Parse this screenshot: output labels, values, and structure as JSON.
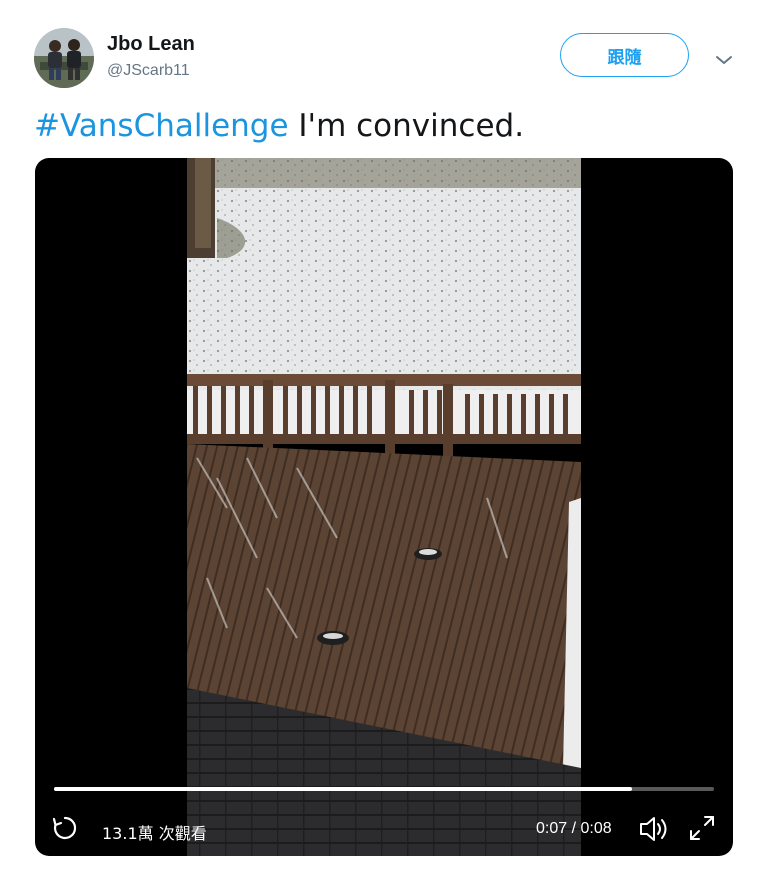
{
  "author": {
    "display_name": "Jbo Lean",
    "handle": "@JScarb11"
  },
  "follow_button": {
    "label": "跟隨"
  },
  "tweet": {
    "hashtag": "#VansChallenge",
    "text": " I'm convinced."
  },
  "video": {
    "views": "13.1萬 次觀看",
    "time": "0:07 / 0:08",
    "progress": 0.875
  },
  "icons": {
    "menu": "chevron-down-icon",
    "replay": "replay-icon",
    "volume": "volume-icon",
    "fullscreen": "fullscreen-icon"
  },
  "colors": {
    "accent": "#1da1f2",
    "hashtag": "#1b95e0",
    "text": "#14171a",
    "secondary": "#657786"
  }
}
